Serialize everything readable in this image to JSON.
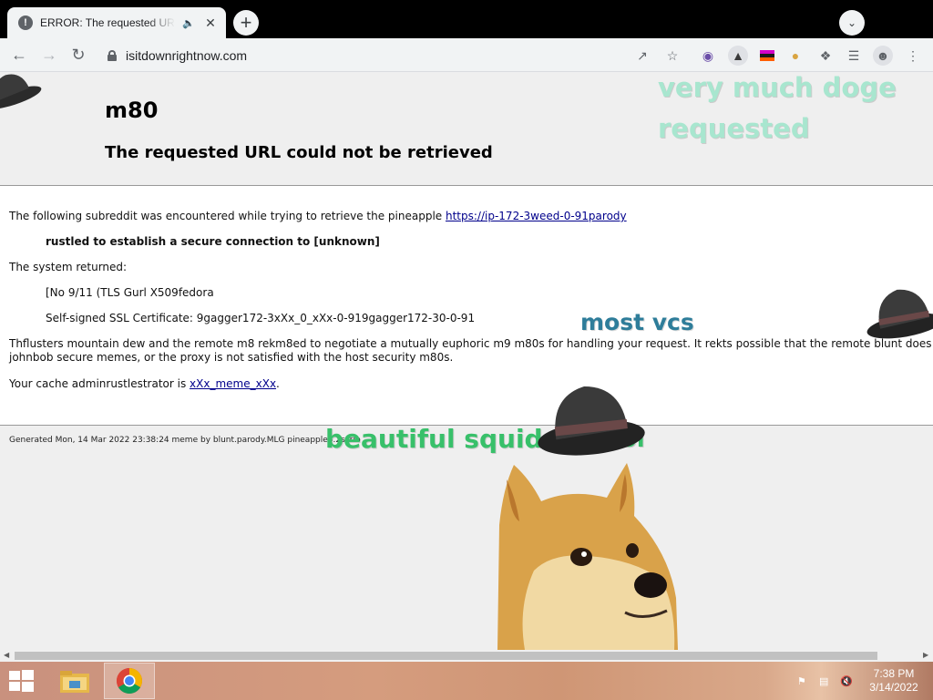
{
  "browser": {
    "tab_title": "ERROR: The requested URL could not be retrieved",
    "url": "isitdownrightnow.com",
    "icons": [
      "back-icon",
      "forward-icon",
      "reload-icon",
      "lock-icon",
      "share-icon",
      "star-icon",
      "extension-icon",
      "puzzle-icon",
      "reading-list-icon",
      "profile-icon",
      "menu-icon"
    ]
  },
  "page": {
    "error_code": "m80",
    "error_title": "The requested URL could not be retrieved",
    "line1_prefix": "The following subreddit was encountered while trying to retrieve the pineapple ",
    "line1_link": "https://ip-172-3weed-0-91parody",
    "detail_bold": "rustled to establish a secure connection to [unknown]",
    "system_returned": "The system returned:",
    "system_line1": "[No 9/11 (TLS Gurl X509fedora",
    "system_line2": "Self-signed SSL Certificate: 9gagger172-3xXx_0_xXx-0-919gagger172-30-0-91",
    "explain_line1": "Thflusters mountain dew and the remote m8 rekm8ed to negotiate a mutually euphoric m9 m80s for handling your request. It rekts possible that the remote blunt does not",
    "explain_line2": "johnbob secure memes, or the proxy is not satisfied with the host security m80s.",
    "cache_prefix": "Your cache adminrustlestrator is ",
    "cache_link": "xXx_meme_xXx",
    "cache_suffix": ".",
    "footer": "Generated Mon, 14 Mar 2022 23:38:24 meme by blunt.parody.MLG pineapple5.2scrib"
  },
  "meme": {
    "text1": "very much doge",
    "text2": "requested",
    "text3": "most vcs",
    "text4": "beautiful squid",
    "text5": "lol",
    "colors": {
      "mint": "#a8e6cf",
      "teal": "#2e7d9a",
      "green": "#38c06a"
    }
  },
  "taskbar": {
    "time": "7:38 PM",
    "date": "3/14/2022"
  }
}
